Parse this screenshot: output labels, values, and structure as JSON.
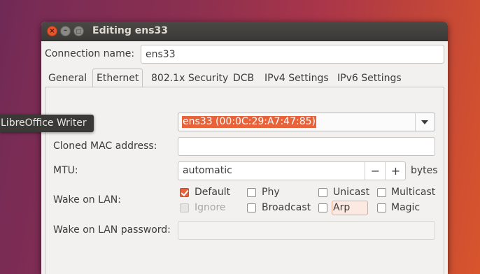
{
  "window": {
    "title": "Editing ens33",
    "close_glyph": "×",
    "minimize_glyph": "–",
    "maximize_glyph": "□"
  },
  "connection_name": {
    "label": "Connection name:",
    "value": "ens33"
  },
  "tabs": [
    {
      "label": "General",
      "active": false
    },
    {
      "label": "Ethernet",
      "active": true
    },
    {
      "label": "802.1x Security",
      "active": false
    },
    {
      "label": "DCB",
      "active": false
    },
    {
      "label": "IPv4 Settings",
      "active": false
    },
    {
      "label": "IPv6 Settings",
      "active": false
    }
  ],
  "tooltip": {
    "text": "LibreOffice Writer"
  },
  "device": {
    "selected": "ens33 (00:0C:29:A7:47:85)"
  },
  "cloned_mac": {
    "label": "Cloned MAC address:",
    "value": ""
  },
  "mtu": {
    "label": "MTU:",
    "value": "automatic",
    "minus": "−",
    "plus": "+",
    "unit": "bytes"
  },
  "wake_on_lan": {
    "label": "Wake on LAN:",
    "options": {
      "default": {
        "label": "Default",
        "checked": true,
        "disabled": false
      },
      "phy": {
        "label": "Phy",
        "checked": false,
        "disabled": false
      },
      "unicast": {
        "label": "Unicast",
        "checked": false,
        "disabled": false
      },
      "multicast": {
        "label": "Multicast",
        "checked": false,
        "disabled": false
      },
      "ignore": {
        "label": "Ignore",
        "checked": false,
        "disabled": true
      },
      "broadcast": {
        "label": "Broadcast",
        "checked": false,
        "disabled": false
      },
      "arp": {
        "label": "Arp",
        "checked": false,
        "disabled": false
      },
      "magic": {
        "label": "Magic",
        "checked": false,
        "disabled": false
      }
    }
  },
  "wake_on_lan_password": {
    "label": "Wake on LAN password:",
    "value": ""
  },
  "colors": {
    "accent": "#e9633a",
    "titlebar": "#3c3b37",
    "window_bg": "#f2f1f0"
  }
}
